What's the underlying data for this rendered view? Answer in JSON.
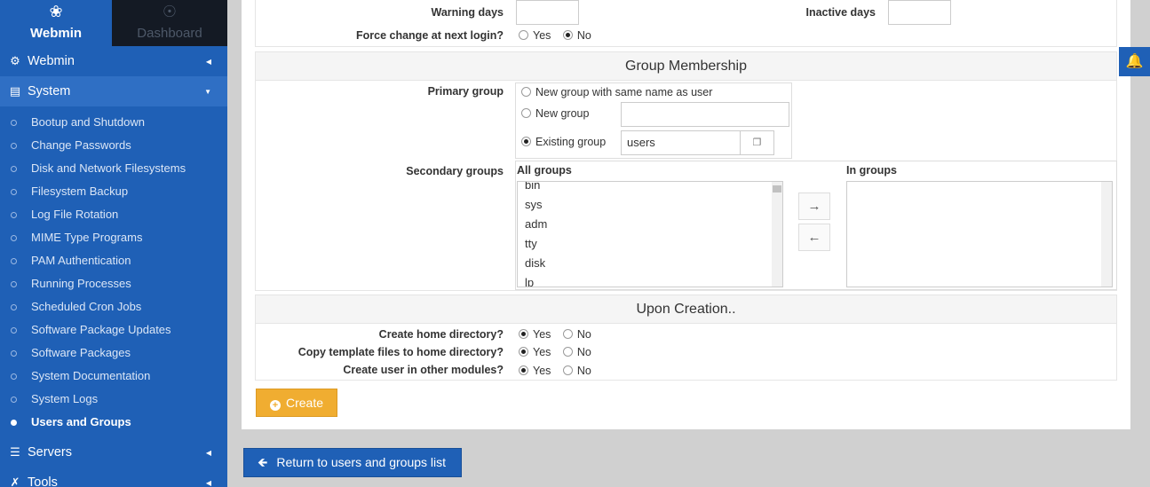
{
  "sidebar": {
    "tabs": [
      {
        "label": "Webmin",
        "icon": "webmin-logo-icon"
      },
      {
        "label": "Dashboard",
        "icon": "gauge-icon"
      }
    ],
    "categories": {
      "webmin": {
        "label": "Webmin",
        "icon": "gear-icon"
      },
      "system": {
        "label": "System",
        "icon": "laptop-icon"
      },
      "servers": {
        "label": "Servers",
        "icon": "server-icon"
      },
      "tools": {
        "label": "Tools",
        "icon": "wrench-icon"
      }
    },
    "system_items": [
      "Bootup and Shutdown",
      "Change Passwords",
      "Disk and Network Filesystems",
      "Filesystem Backup",
      "Log File Rotation",
      "MIME Type Programs",
      "PAM Authentication",
      "Running Processes",
      "Scheduled Cron Jobs",
      "Software Package Updates",
      "Software Packages",
      "System Documentation",
      "System Logs",
      "Users and Groups"
    ]
  },
  "password_options": {
    "warning_days_label": "Warning days",
    "warning_days_value": "",
    "inactive_days_label": "Inactive days",
    "inactive_days_value": "",
    "force_change_label": "Force change at next login?",
    "yes": "Yes",
    "no": "No",
    "force_change_selected": "No"
  },
  "group_membership": {
    "title": "Group Membership",
    "primary_label": "Primary group",
    "opt_same_name": "New group with same name as user",
    "opt_new_group": "New group",
    "new_group_value": "",
    "opt_existing": "Existing group",
    "existing_value": "users",
    "primary_selected": "Existing group",
    "secondary_label": "Secondary groups",
    "all_groups_label": "All groups",
    "in_groups_label": "In groups",
    "all_groups": [
      "bin",
      "sys",
      "adm",
      "tty",
      "disk",
      "lp"
    ],
    "in_groups": []
  },
  "upon_creation": {
    "title": "Upon Creation..",
    "home_dir_label": "Create home directory?",
    "copy_template_label": "Copy template files to home directory?",
    "other_modules_label": "Create user in other modules?",
    "yes": "Yes",
    "no": "No",
    "home_dir_selected": "Yes",
    "copy_template_selected": "Yes",
    "other_modules_selected": "Yes"
  },
  "buttons": {
    "create": "Create",
    "return": "Return to users and groups list"
  },
  "colors": {
    "sidebar": "#1f60b6",
    "create_button": "#f0ad31"
  }
}
